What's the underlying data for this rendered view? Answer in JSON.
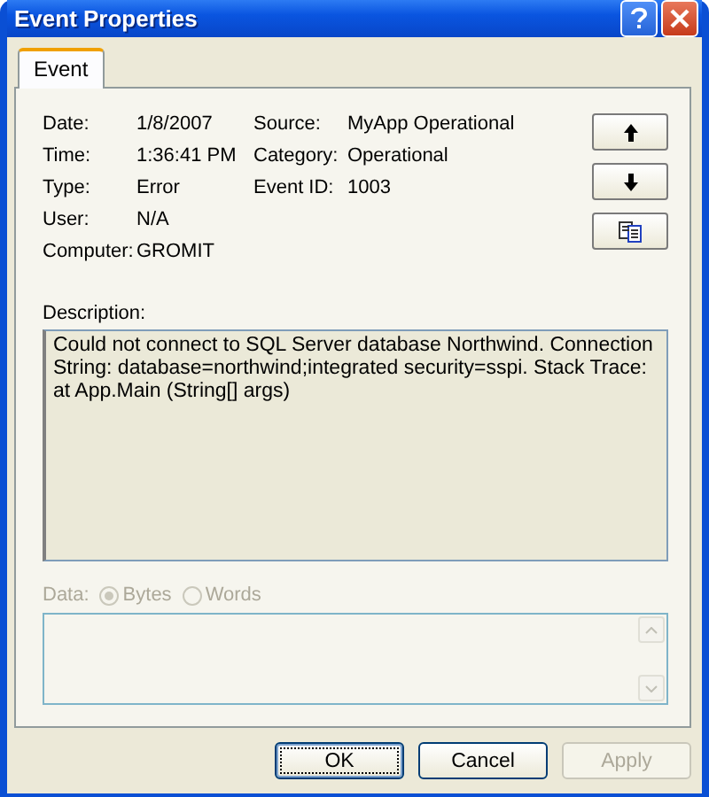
{
  "window": {
    "title": "Event Properties"
  },
  "tabs": [
    {
      "label": "Event",
      "selected": true
    }
  ],
  "fields_left": [
    {
      "label": "Date:",
      "value": "1/8/2007"
    },
    {
      "label": "Time:",
      "value": "1:36:41 PM"
    },
    {
      "label": "Type:",
      "value": "Error"
    },
    {
      "label": "User:",
      "value": "N/A"
    },
    {
      "label": "Computer:",
      "value": "GROMIT"
    }
  ],
  "fields_right": [
    {
      "label": "Source:",
      "value": "MyApp Operational"
    },
    {
      "label": "Category:",
      "value": "Operational"
    },
    {
      "label": "Event ID:",
      "value": "1003"
    }
  ],
  "nav_buttons": [
    {
      "kind": "up"
    },
    {
      "kind": "down"
    },
    {
      "kind": "copy"
    }
  ],
  "description": {
    "label": "Description:",
    "text": "Could not connect to SQL Server database Northwind. Connection String: database=northwind;integrated security=sspi. Stack Trace:     at App.Main (String[] args)"
  },
  "data": {
    "label": "Data:",
    "disabled": true,
    "options": [
      {
        "label": "Bytes",
        "selected": true
      },
      {
        "label": "Words",
        "selected": false
      }
    ]
  },
  "buttons": [
    {
      "label": "OK",
      "default": true,
      "disabled": false
    },
    {
      "label": "Cancel",
      "default": false,
      "disabled": false
    },
    {
      "label": "Apply",
      "default": false,
      "disabled": true
    }
  ]
}
